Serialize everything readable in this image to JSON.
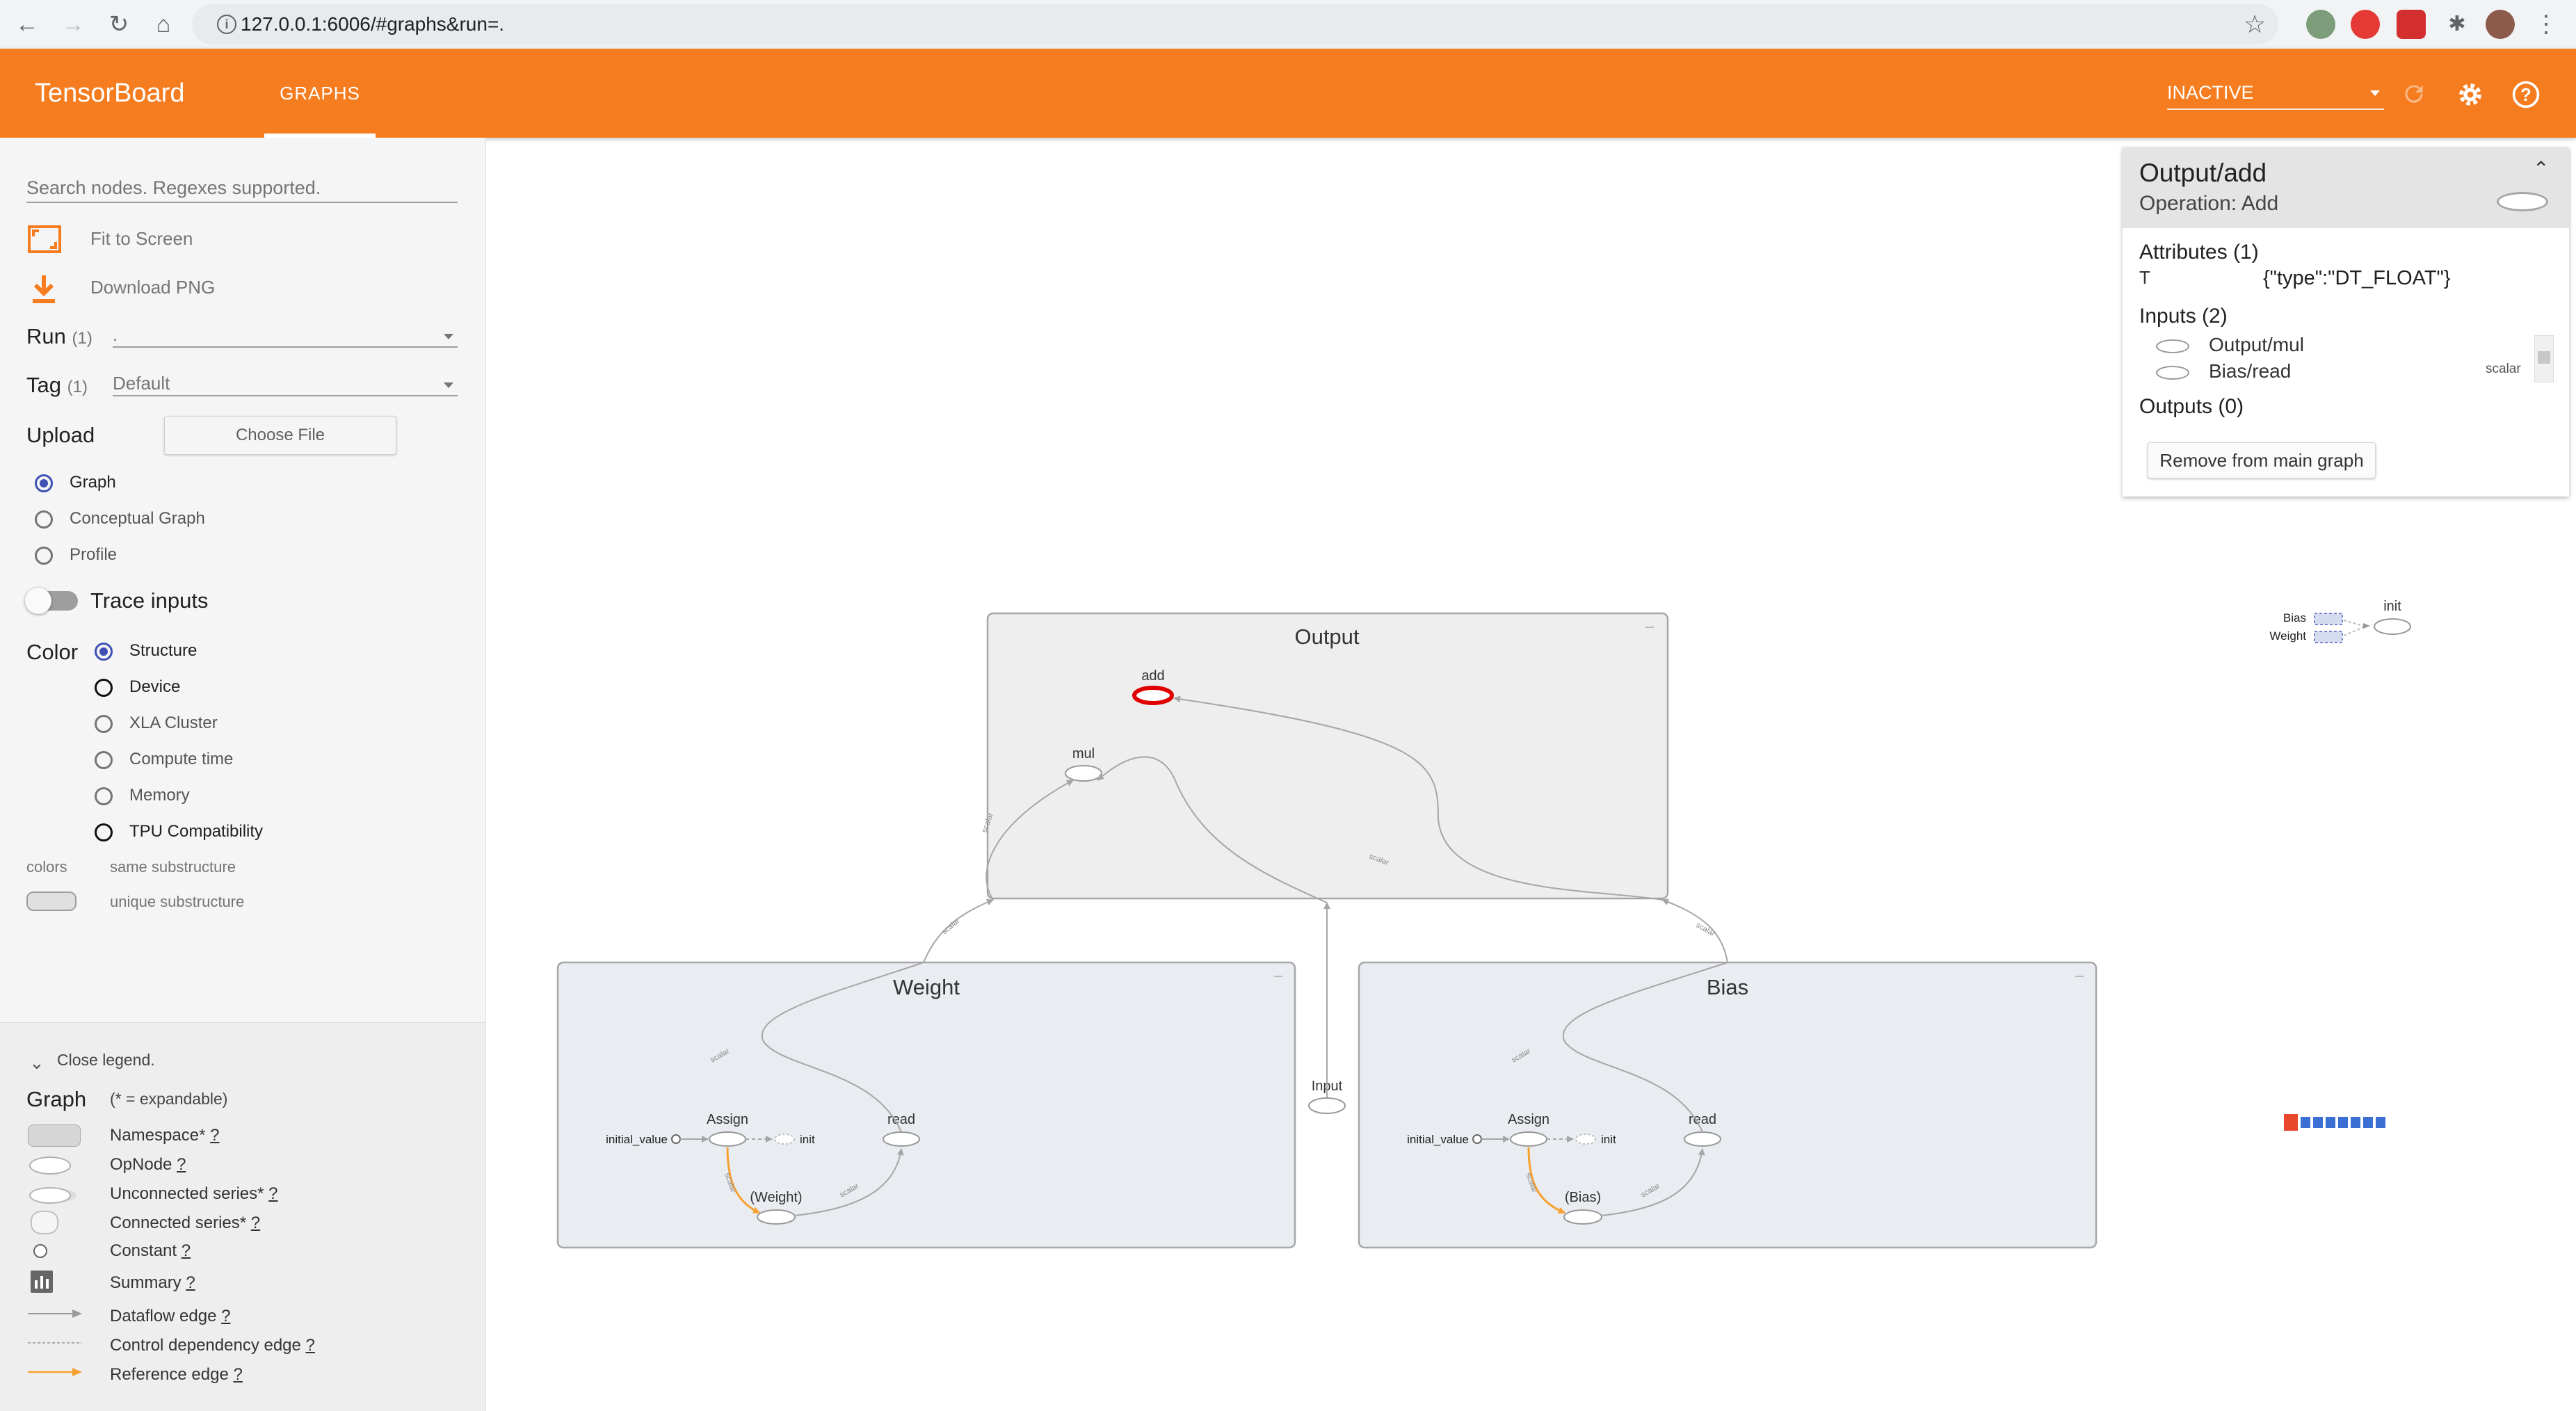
{
  "browser": {
    "url": "127.0.0.1:6006/#graphs&run=.",
    "icons": [
      "back-icon",
      "forward-icon",
      "reload-icon",
      "home-icon",
      "info-icon",
      "star-icon",
      "extensions-icon",
      "profile-avatar",
      "kebab-menu-icon"
    ]
  },
  "header": {
    "logo": "TensorBoard",
    "tab": "GRAPHS",
    "run_status": "INACTIVE",
    "colors": {
      "bar": "#f57c1f",
      "text": "#ffffff"
    }
  },
  "sidebar": {
    "search_placeholder": "Search nodes. Regexes supported.",
    "fit_to_screen": "Fit to Screen",
    "download_png": "Download PNG",
    "run_label": "Run",
    "run_count": "(1)",
    "run_value": ".",
    "tag_label": "Tag",
    "tag_count": "(1)",
    "tag_value": "Default",
    "upload_label": "Upload",
    "choose_file": "Choose File",
    "graph_modes": [
      "Graph",
      "Conceptual Graph",
      "Profile"
    ],
    "trace_inputs": "Trace inputs",
    "color_label": "Color",
    "color_modes": [
      "Structure",
      "Device",
      "XLA Cluster",
      "Compute time",
      "Memory",
      "TPU Compatibility"
    ],
    "colors_label": "colors",
    "same_substructure": "same substructure",
    "unique_substructure": "unique substructure"
  },
  "legend": {
    "toggle": "Close legend.",
    "title": "Graph",
    "subtitle": "(* = expandable)",
    "help": "?",
    "items": [
      "Namespace*",
      "OpNode",
      "Unconnected series*",
      "Connected series*",
      "Constant",
      "Summary",
      "Dataflow edge",
      "Control dependency edge",
      "Reference edge"
    ]
  },
  "info": {
    "title": "Output/add",
    "operation": "Operation: Add",
    "attributes_heading": "Attributes (1)",
    "attr_key": "T",
    "attr_value": "{\"type\":\"DT_FLOAT\"}",
    "inputs_heading": "Inputs (2)",
    "inputs": [
      "Output/mul",
      "Bias/read"
    ],
    "input_shape": "scalar",
    "outputs_heading": "Outputs (0)",
    "remove_button": "Remove from main graph"
  },
  "graph": {
    "output": {
      "title": "Output",
      "add": "add",
      "mul": "mul"
    },
    "weight": {
      "title": "Weight",
      "initial_value": "initial_value",
      "assign": "Assign",
      "init": "init",
      "read": "read",
      "var": "(Weight)"
    },
    "bias": {
      "title": "Bias",
      "initial_value": "initial_value",
      "assign": "Assign",
      "init": "init",
      "read": "read",
      "var": "(Bias)"
    },
    "input": "Input",
    "edge_label": "scalar",
    "minimap": {
      "bias": "Bias",
      "weight": "Weight",
      "init": "init"
    },
    "colors": {
      "namespace": "#e9ecf0",
      "output_namespace": "#eeeeee",
      "selected": "#e00000",
      "edge": "#a6a6a6",
      "reference": "#f7a131"
    }
  }
}
